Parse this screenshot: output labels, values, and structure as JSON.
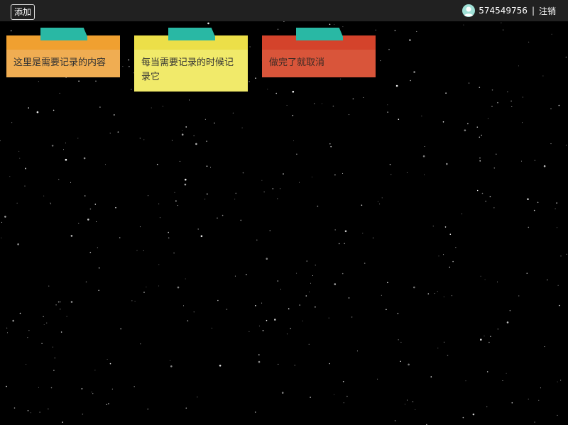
{
  "toolbar": {
    "add_label": "添加"
  },
  "user": {
    "id": "574549756",
    "separator": "|",
    "logout_label": "注销"
  },
  "notes": [
    {
      "text": "这里是需要记录的内容",
      "color": "#f0ad52"
    },
    {
      "text": "每当需要记录的时候记录它",
      "color": "#f1ea6a"
    },
    {
      "text": "做完了就取消",
      "color": "#d9553a"
    }
  ],
  "colors": {
    "background": "#000000",
    "topbar": "#212121",
    "tape": "#29b8a4",
    "avatar": "#9fe0d6"
  }
}
